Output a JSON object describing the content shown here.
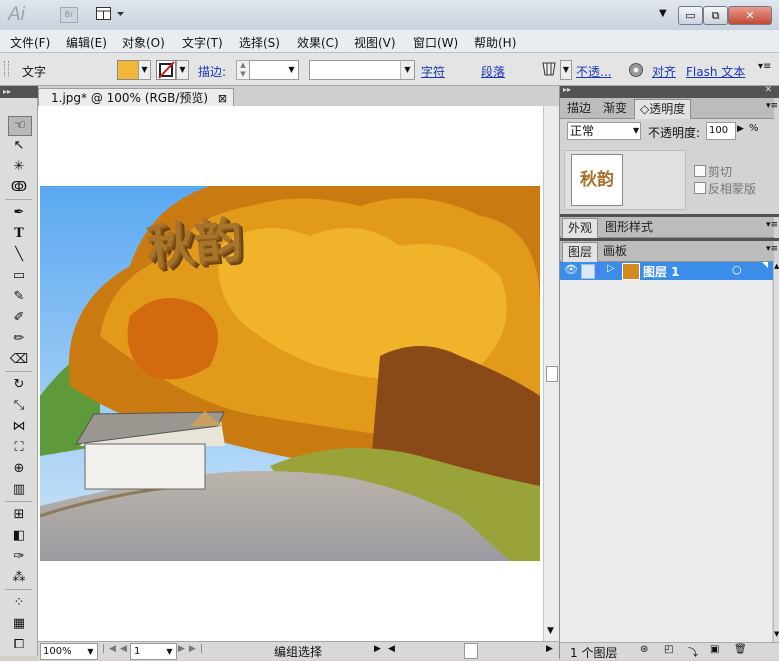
{
  "app": {
    "logo": "Ai",
    "bridge_label": "Br",
    "window_buttons": {
      "minimize": "▭",
      "restore": "⧉",
      "close": "✕"
    },
    "ellipsis_arrow": "▼"
  },
  "menu": [
    "文件(F)",
    "编辑(E)",
    "对象(O)",
    "文字(T)",
    "选择(S)",
    "效果(C)",
    "视图(V)",
    "窗口(W)",
    "帮助(H)"
  ],
  "control_bar": {
    "label": "文字",
    "fill_color": "#f3b739",
    "stroke_label": "描边:",
    "char_link": "字符",
    "para_link": "段落",
    "opacity_link": "不透...",
    "align_link": "对齐",
    "flash_link": "Flash 文本"
  },
  "document": {
    "tab_title": "1.jpg* @ 100% (RGB/预览)",
    "close_icon": "⊠",
    "artwork_text": "秋韵",
    "zoom": "100%",
    "page": "1",
    "status_label": "编组选择"
  },
  "panels": {
    "top_tabs": [
      "描边",
      "渐变",
      "◇透明度"
    ],
    "blend_mode": "正常",
    "opacity_label": "不透明度:",
    "opacity_value": "100",
    "opacity_unit": "%",
    "thumb_text": "秋韵",
    "clip_label": "剪切",
    "invert_mask_label": "反相蒙版",
    "appearance_tabs": [
      "外观",
      "图形样式"
    ],
    "layers_tabs": [
      "图层",
      "画板"
    ],
    "layer_name": "图层 1",
    "layer_count": "1 个图层"
  }
}
